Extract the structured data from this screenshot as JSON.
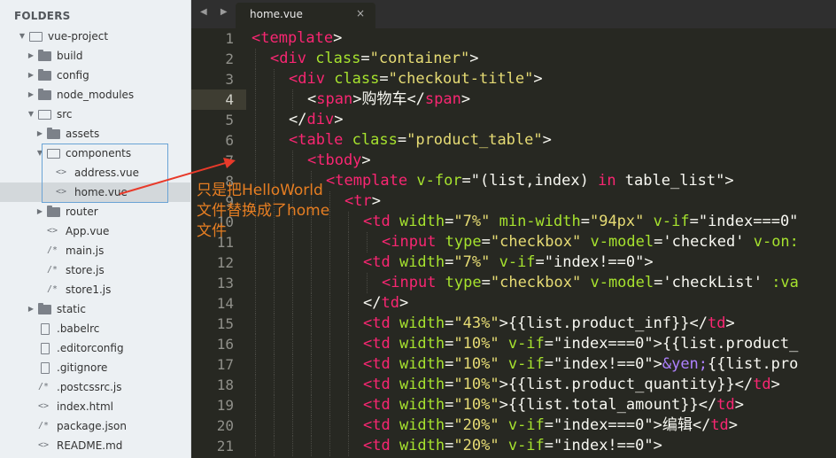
{
  "sidebar": {
    "title": "FOLDERS",
    "items": [
      {
        "label": "vue-project",
        "type": "folder-open",
        "depth": 0,
        "expanded": true
      },
      {
        "label": "build",
        "type": "folder",
        "depth": 1
      },
      {
        "label": "config",
        "type": "folder",
        "depth": 1
      },
      {
        "label": "node_modules",
        "type": "folder",
        "depth": 1
      },
      {
        "label": "src",
        "type": "folder-open",
        "depth": 1,
        "expanded": true
      },
      {
        "label": "assets",
        "type": "folder",
        "depth": 2
      },
      {
        "label": "components",
        "type": "folder-open",
        "depth": 2,
        "expanded": true
      },
      {
        "label": "address.vue",
        "type": "code",
        "depth": 3
      },
      {
        "label": "home.vue",
        "type": "code",
        "depth": 3,
        "selected": true
      },
      {
        "label": "router",
        "type": "folder",
        "depth": 2
      },
      {
        "label": "App.vue",
        "type": "code",
        "depth": 2
      },
      {
        "label": "main.js",
        "type": "comment",
        "depth": 2
      },
      {
        "label": "store.js",
        "type": "comment",
        "depth": 2
      },
      {
        "label": "store1.js",
        "type": "comment",
        "depth": 2
      },
      {
        "label": "static",
        "type": "folder",
        "depth": 1
      },
      {
        "label": ".babelrc",
        "type": "file",
        "depth": 1
      },
      {
        "label": ".editorconfig",
        "type": "file",
        "depth": 1
      },
      {
        "label": ".gitignore",
        "type": "file",
        "depth": 1
      },
      {
        "label": ".postcssrc.js",
        "type": "comment",
        "depth": 1
      },
      {
        "label": "index.html",
        "type": "code",
        "depth": 1
      },
      {
        "label": "package.json",
        "type": "comment",
        "depth": 1
      },
      {
        "label": "README.md",
        "type": "code",
        "depth": 1
      }
    ]
  },
  "tabbar": {
    "nav": "◀ ▶",
    "active_tab": "home.vue",
    "close_glyph": "×"
  },
  "editor": {
    "current_line": 4,
    "lines": [
      {
        "n": "1",
        "indent": 0,
        "tokens": [
          [
            "t",
            "<template"
          ],
          [
            "w",
            ">"
          ]
        ]
      },
      {
        "n": "2",
        "indent": 1,
        "tokens": [
          [
            "t",
            "<div "
          ],
          [
            "a",
            "class"
          ],
          [
            "w",
            "="
          ],
          [
            "s",
            "\"container\""
          ],
          [
            "w",
            ">"
          ]
        ]
      },
      {
        "n": "3",
        "indent": 2,
        "tokens": [
          [
            "t",
            "<div "
          ],
          [
            "a",
            "class"
          ],
          [
            "w",
            "="
          ],
          [
            "s",
            "\"checkout-title\""
          ],
          [
            "w",
            ">"
          ]
        ]
      },
      {
        "n": "4",
        "indent": 3,
        "tokens": [
          [
            "w",
            "<"
          ],
          [
            "t",
            "span"
          ],
          [
            "w",
            ">购物车</"
          ],
          [
            "t",
            "span"
          ],
          [
            "w",
            ">"
          ]
        ]
      },
      {
        "n": "5",
        "indent": 2,
        "tokens": [
          [
            "w",
            "</"
          ],
          [
            "t",
            "div"
          ],
          [
            "w",
            ">"
          ]
        ]
      },
      {
        "n": "6",
        "indent": 2,
        "tokens": [
          [
            "t",
            "<table "
          ],
          [
            "a",
            "class"
          ],
          [
            "w",
            "="
          ],
          [
            "s",
            "\"product_table\""
          ],
          [
            "w",
            ">"
          ]
        ]
      },
      {
        "n": "7",
        "indent": 3,
        "tokens": [
          [
            "t",
            "<tbody"
          ],
          [
            "w",
            ">"
          ]
        ]
      },
      {
        "n": "8",
        "indent": 4,
        "tokens": [
          [
            "t",
            "<template "
          ],
          [
            "a",
            "v-for"
          ],
          [
            "w",
            "=\"(list,index) "
          ],
          [
            "t",
            "in"
          ],
          [
            "w",
            " table_list\">"
          ]
        ]
      },
      {
        "n": "9",
        "indent": 5,
        "tokens": [
          [
            "t",
            "<tr"
          ],
          [
            "w",
            ">"
          ]
        ]
      },
      {
        "n": "10",
        "indent": 6,
        "tokens": [
          [
            "t",
            "<td "
          ],
          [
            "a",
            "width"
          ],
          [
            "w",
            "="
          ],
          [
            "s",
            "\"7%\""
          ],
          [
            "w",
            " "
          ],
          [
            "a",
            "min-width"
          ],
          [
            "w",
            "="
          ],
          [
            "s",
            "\"94px\""
          ],
          [
            "w",
            " "
          ],
          [
            "a",
            "v-if"
          ],
          [
            "w",
            "=\"index===0\""
          ]
        ]
      },
      {
        "n": "11",
        "indent": 7,
        "tokens": [
          [
            "t",
            "<input "
          ],
          [
            "a",
            "type"
          ],
          [
            "w",
            "="
          ],
          [
            "s",
            "\"checkbox\""
          ],
          [
            "w",
            " "
          ],
          [
            "a",
            "v-model"
          ],
          [
            "w",
            "='checked' "
          ],
          [
            "a",
            "v-on:"
          ]
        ]
      },
      {
        "n": "12",
        "indent": 6,
        "tokens": [
          [
            "t",
            "<td "
          ],
          [
            "a",
            "width"
          ],
          [
            "w",
            "="
          ],
          [
            "s",
            "\"7%\""
          ],
          [
            "w",
            " "
          ],
          [
            "a",
            "v-if"
          ],
          [
            "w",
            "=\"index!==0\">"
          ]
        ]
      },
      {
        "n": "13",
        "indent": 7,
        "tokens": [
          [
            "t",
            "<input "
          ],
          [
            "a",
            "type"
          ],
          [
            "w",
            "="
          ],
          [
            "s",
            "\"checkbox\""
          ],
          [
            "w",
            " "
          ],
          [
            "a",
            "v-model"
          ],
          [
            "w",
            "='checkList' "
          ],
          [
            "a",
            ":va"
          ]
        ]
      },
      {
        "n": "14",
        "indent": 6,
        "tokens": [
          [
            "w",
            "</"
          ],
          [
            "t",
            "td"
          ],
          [
            "w",
            ">"
          ]
        ]
      },
      {
        "n": "15",
        "indent": 6,
        "tokens": [
          [
            "t",
            "<td "
          ],
          [
            "a",
            "width"
          ],
          [
            "w",
            "="
          ],
          [
            "s",
            "\"43%\""
          ],
          [
            "w",
            ">{{list.product_inf}}</"
          ],
          [
            "t",
            "td"
          ],
          [
            "w",
            ">"
          ]
        ]
      },
      {
        "n": "16",
        "indent": 6,
        "tokens": [
          [
            "t",
            "<td "
          ],
          [
            "a",
            "width"
          ],
          [
            "w",
            "="
          ],
          [
            "s",
            "\"10%\""
          ],
          [
            "w",
            " "
          ],
          [
            "a",
            "v-if"
          ],
          [
            "w",
            "=\"index===0\">{{list.product_"
          ]
        ]
      },
      {
        "n": "17",
        "indent": 6,
        "tokens": [
          [
            "t",
            "<td "
          ],
          [
            "a",
            "width"
          ],
          [
            "w",
            "="
          ],
          [
            "s",
            "\"10%\""
          ],
          [
            "w",
            " "
          ],
          [
            "a",
            "v-if"
          ],
          [
            "w",
            "=\"index!==0\">"
          ],
          [
            "e",
            "&yen;"
          ],
          [
            "w",
            "{{list.pro"
          ]
        ]
      },
      {
        "n": "18",
        "indent": 6,
        "tokens": [
          [
            "t",
            "<td "
          ],
          [
            "a",
            "width"
          ],
          [
            "w",
            "="
          ],
          [
            "s",
            "\"10%\""
          ],
          [
            "w",
            ">{{list.product_quantity}}</"
          ],
          [
            "t",
            "td"
          ],
          [
            "w",
            ">"
          ]
        ]
      },
      {
        "n": "19",
        "indent": 6,
        "tokens": [
          [
            "t",
            "<td "
          ],
          [
            "a",
            "width"
          ],
          [
            "w",
            "="
          ],
          [
            "s",
            "\"10%\""
          ],
          [
            "w",
            ">{{list.total_amount}}</"
          ],
          [
            "t",
            "td"
          ],
          [
            "w",
            ">"
          ]
        ]
      },
      {
        "n": "20",
        "indent": 6,
        "tokens": [
          [
            "t",
            "<td "
          ],
          [
            "a",
            "width"
          ],
          [
            "w",
            "="
          ],
          [
            "s",
            "\"20%\""
          ],
          [
            "w",
            " "
          ],
          [
            "a",
            "v-if"
          ],
          [
            "w",
            "=\"index===0\">编辑</"
          ],
          [
            "t",
            "td"
          ],
          [
            "w",
            ">"
          ]
        ]
      },
      {
        "n": "21",
        "indent": 6,
        "tokens": [
          [
            "t",
            "<td "
          ],
          [
            "a",
            "width"
          ],
          [
            "w",
            "="
          ],
          [
            "s",
            "\"20%\""
          ],
          [
            "w",
            " "
          ],
          [
            "a",
            "v-if"
          ],
          [
            "w",
            "=\"index!==0\">"
          ]
        ]
      }
    ]
  },
  "annotation": {
    "text_line1": "只是把HelloWorld",
    "text_line2": "文件替换成了home",
    "text_line3": "文件",
    "color": "#e67e22",
    "arrow_color": "#e83a2a"
  },
  "theme": {
    "editor_bg": "#272822",
    "tag": "#f92672",
    "attr": "#a6e22e",
    "string": "#e6db74",
    "sidebar_bg": "#ecf0f3"
  }
}
